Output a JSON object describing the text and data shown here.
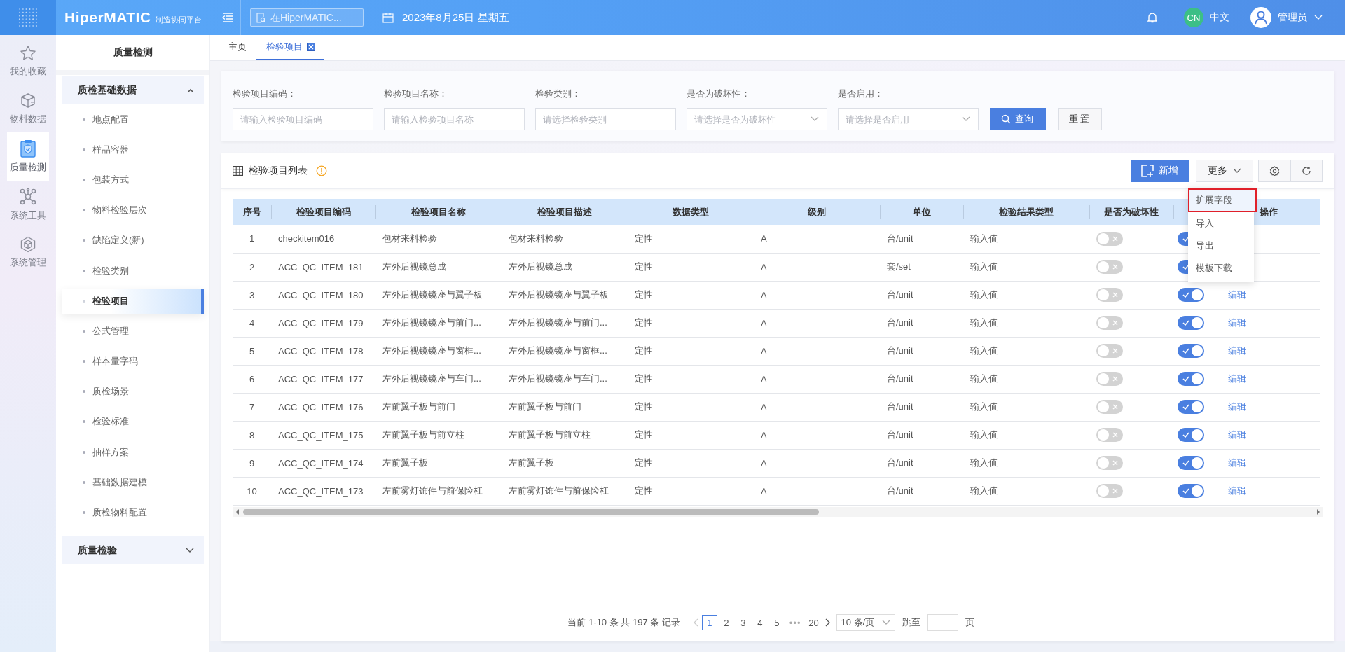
{
  "header": {
    "logo": "HiperMATIC",
    "logo_subtitle": "制造协同平台",
    "search": {
      "placeholder": "在HiperMATIC..."
    },
    "date": "2023年8月25日 星期五",
    "language_badge": "CN",
    "language": "中文",
    "user": "管理员"
  },
  "rail": [
    {
      "label": "我的收藏",
      "kind": "star",
      "selected": false
    },
    {
      "label": "物料数据",
      "kind": "box",
      "selected": false
    },
    {
      "label": "质量检测",
      "kind": "clipboard",
      "selected": true
    },
    {
      "label": "系统工具",
      "kind": "network",
      "selected": false
    },
    {
      "label": "系统管理",
      "kind": "cube",
      "selected": false
    }
  ],
  "sidebar": {
    "title": "质量检测",
    "groups": [
      {
        "label": "质检基础数据",
        "expanded": true,
        "children": [
          {
            "label": "地点配置",
            "selected": false
          },
          {
            "label": "样品容器",
            "selected": false
          },
          {
            "label": "包装方式",
            "selected": false
          },
          {
            "label": "物料检验层次",
            "selected": false
          },
          {
            "label": "缺陷定义(新)",
            "selected": false
          },
          {
            "label": "检验类别",
            "selected": false
          },
          {
            "label": "检验项目",
            "selected": true
          },
          {
            "label": "公式管理",
            "selected": false
          },
          {
            "label": "样本量字码",
            "selected": false
          },
          {
            "label": "质检场景",
            "selected": false
          },
          {
            "label": "检验标准",
            "selected": false
          },
          {
            "label": "抽样方案",
            "selected": false
          },
          {
            "label": "基础数据建模",
            "selected": false
          },
          {
            "label": "质检物料配置",
            "selected": false
          }
        ]
      },
      {
        "label": "质量检验",
        "expanded": false
      }
    ]
  },
  "tabs": [
    {
      "label": "主页",
      "selected": false,
      "closable": false
    },
    {
      "label": "检验项目",
      "selected": true,
      "closable": true
    }
  ],
  "filters": [
    {
      "label": "检验项目编码：",
      "placeholder": "请输入检验项目编码",
      "kind": "input"
    },
    {
      "label": "检验项目名称：",
      "placeholder": "请输入检验项目名称",
      "kind": "input"
    },
    {
      "label": "检验类别：",
      "placeholder": "请选择检验类别",
      "kind": "input"
    },
    {
      "label": "是否为破坏性：",
      "placeholder": "请选择是否为破坏性",
      "kind": "select"
    },
    {
      "label": "是否启用：",
      "placeholder": "请选择是否启用",
      "kind": "select"
    }
  ],
  "filter_buttons": [
    {
      "label": "查询",
      "kind": "primary"
    },
    {
      "label": "重置",
      "kind": "default"
    }
  ],
  "table_card": {
    "title": "检验项目列表",
    "actions": [
      {
        "label": "新增",
        "kind": "add"
      },
      {
        "label": "更多",
        "kind": "dropdown"
      },
      {
        "kind": "settings"
      },
      {
        "kind": "refresh"
      }
    ]
  },
  "more_menu": [
    {
      "label": "扩展字段",
      "highlighted": true
    },
    {
      "label": "导入",
      "highlighted": false
    },
    {
      "label": "导出",
      "highlighted": false
    },
    {
      "label": "模板下载",
      "highlighted": false
    }
  ],
  "columns": [
    "序号",
    "检验项目编码",
    "检验项目名称",
    "检验项目描述",
    "数据类型",
    "级别",
    "单位",
    "检验结果类型",
    "是否为破坏性",
    "操作"
  ],
  "rows": [
    {
      "index": "1",
      "code": "checkitem016",
      "name": "包材来料检验",
      "description": "包材来料检验",
      "data_type": "定性",
      "grade": "A",
      "unit": "台/unit",
      "result_type": "输入值",
      "destructive": false,
      "enabled": true
    },
    {
      "index": "2",
      "code": "ACC_QC_ITEM_181",
      "name": "左外后视镜总成",
      "description": "左外后视镜总成",
      "data_type": "定性",
      "grade": "A",
      "unit": "套/set",
      "result_type": "输入值",
      "destructive": false,
      "enabled": true
    },
    {
      "index": "3",
      "code": "ACC_QC_ITEM_180",
      "name": "左外后视镜镜座与翼子板",
      "description": "左外后视镜镜座与翼子板",
      "data_type": "定性",
      "grade": "A",
      "unit": "台/unit",
      "result_type": "输入值",
      "destructive": false,
      "enabled": true,
      "action": "编辑"
    },
    {
      "index": "4",
      "code": "ACC_QC_ITEM_179",
      "name": "左外后视镜镜座与前门...",
      "description": "左外后视镜镜座与前门...",
      "data_type": "定性",
      "grade": "A",
      "unit": "台/unit",
      "result_type": "输入值",
      "destructive": false,
      "enabled": true,
      "action": "编辑"
    },
    {
      "index": "5",
      "code": "ACC_QC_ITEM_178",
      "name": "左外后视镜镜座与窗框...",
      "description": "左外后视镜镜座与窗框...",
      "data_type": "定性",
      "grade": "A",
      "unit": "台/unit",
      "result_type": "输入值",
      "destructive": false,
      "enabled": true,
      "action": "编辑"
    },
    {
      "index": "6",
      "code": "ACC_QC_ITEM_177",
      "name": "左外后视镜镜座与车门...",
      "description": "左外后视镜镜座与车门...",
      "data_type": "定性",
      "grade": "A",
      "unit": "台/unit",
      "result_type": "输入值",
      "destructive": false,
      "enabled": true,
      "action": "编辑"
    },
    {
      "index": "7",
      "code": "ACC_QC_ITEM_176",
      "name": "左前翼子板与前门",
      "description": "左前翼子板与前门",
      "data_type": "定性",
      "grade": "A",
      "unit": "台/unit",
      "result_type": "输入值",
      "destructive": false,
      "enabled": true,
      "action": "编辑"
    },
    {
      "index": "8",
      "code": "ACC_QC_ITEM_175",
      "name": "左前翼子板与前立柱",
      "description": "左前翼子板与前立柱",
      "data_type": "定性",
      "grade": "A",
      "unit": "台/unit",
      "result_type": "输入值",
      "destructive": false,
      "enabled": true,
      "action": "编辑"
    },
    {
      "index": "9",
      "code": "ACC_QC_ITEM_174",
      "name": "左前翼子板",
      "description": "左前翼子板",
      "data_type": "定性",
      "grade": "A",
      "unit": "台/unit",
      "result_type": "输入值",
      "destructive": false,
      "enabled": true,
      "action": "编辑"
    },
    {
      "index": "10",
      "code": "ACC_QC_ITEM_173",
      "name": "左前雾灯饰件与前保险杠",
      "description": "左前雾灯饰件与前保险杠",
      "data_type": "定性",
      "grade": "A",
      "unit": "台/unit",
      "result_type": "输入值",
      "destructive": false,
      "enabled": true,
      "action": "编辑"
    }
  ],
  "pagination": {
    "summary": "当前 1-10 条 共 197 条 记录",
    "prev_disabled": true,
    "pages": [
      {
        "label": "1",
        "kind": "page",
        "selected": true
      },
      {
        "label": "2",
        "kind": "page",
        "selected": false
      },
      {
        "label": "3",
        "kind": "page",
        "selected": false
      },
      {
        "label": "4",
        "kind": "page",
        "selected": false
      },
      {
        "label": "5",
        "kind": "page",
        "selected": false
      },
      {
        "label": "•••",
        "kind": "ellipsis"
      },
      {
        "label": "20",
        "kind": "page",
        "selected": false
      }
    ],
    "page_size": "10 条/页",
    "jump_label": "跳至",
    "page_suffix": "页"
  }
}
